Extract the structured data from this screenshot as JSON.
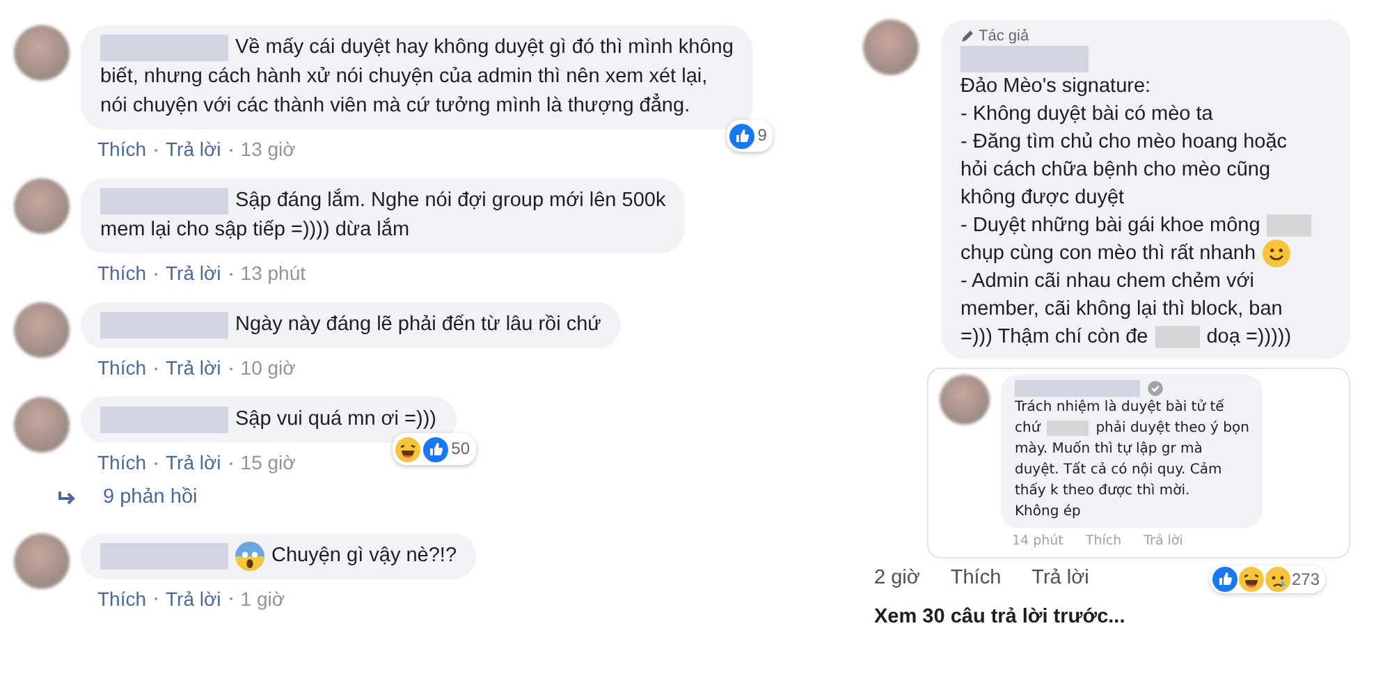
{
  "left_comments": [
    {
      "lines": [
        [
          {
            "kind": "redacted-name"
          },
          {
            "kind": "text",
            "text": "Về mấy cái duyệt hay không duyệt gì đó thì mình không"
          }
        ],
        [
          {
            "kind": "text",
            "text": "biết, nhưng cách hành xử nói chuyện của admin thì nên xem xét lại,"
          }
        ],
        [
          {
            "kind": "text",
            "text": "nói chuyện với các thành viên mà cứ tưởng mình là thượng đẳng."
          }
        ]
      ],
      "reactions": {
        "items": [
          {
            "kind": "like"
          }
        ],
        "count": "9"
      },
      "actions": [
        "Thích",
        "Trả lời"
      ],
      "time": "13 giờ"
    },
    {
      "lines": [
        [
          {
            "kind": "redacted-name"
          },
          {
            "kind": "text",
            "text": "Sập đáng lắm. Nghe nói đợi group mới lên 500k"
          }
        ],
        [
          {
            "kind": "text",
            "text": "mem lại cho sập tiếp =)))) dừa lắm"
          }
        ]
      ],
      "actions": [
        "Thích",
        "Trả lời"
      ],
      "time": "13 phút"
    },
    {
      "lines": [
        [
          {
            "kind": "redacted-name"
          },
          {
            "kind": "text",
            "text": "Ngày này đáng lẽ phải đến từ lâu rồi chứ"
          }
        ]
      ],
      "actions": [
        "Thích",
        "Trả lời"
      ],
      "time": "10 giờ"
    },
    {
      "lines": [
        [
          {
            "kind": "redacted-name"
          },
          {
            "kind": "text",
            "text": "Sập vui quá mn ơi =)))"
          }
        ]
      ],
      "reactions": {
        "items": [
          {
            "kind": "haha"
          },
          {
            "kind": "like"
          }
        ],
        "count": "50"
      },
      "actions": [
        "Thích",
        "Trả lời"
      ],
      "time": "15 giờ",
      "replies": "9 phản hồi"
    },
    {
      "lines": [
        [
          {
            "kind": "redacted-name"
          },
          {
            "kind": "scream-emoji"
          },
          {
            "kind": "text",
            "text": "Chuyện gì vậy nè?!?"
          }
        ]
      ],
      "actions": [
        "Thích",
        "Trả lời"
      ],
      "time": "1 giờ"
    }
  ],
  "author_comment": {
    "badge": "Tác giả",
    "lines": [
      [
        {
          "kind": "redacted-name"
        }
      ],
      [
        {
          "kind": "text",
          "text": "Đảo Mèo's signature:"
        }
      ],
      [
        {
          "kind": "text",
          "text": "- Không duyệt bài có mèo ta"
        }
      ],
      [
        {
          "kind": "text",
          "text": "- Đăng tìm chủ cho mèo hoang hoặc"
        }
      ],
      [
        {
          "kind": "text",
          "text": "hỏi cách chữa bệnh cho mèo cũng"
        }
      ],
      [
        {
          "kind": "text",
          "text": "không được duyệt"
        }
      ],
      [
        {
          "kind": "text",
          "text": "- Duyệt những bài gái khoe mông"
        },
        {
          "kind": "redacted-word"
        }
      ],
      [
        {
          "kind": "text",
          "text": "chụp cùng con mèo thì rất nhanh"
        },
        {
          "kind": "smile-emoji"
        }
      ],
      [
        {
          "kind": "text",
          "text": "- Admin cãi nhau chem chẻm với"
        }
      ],
      [
        {
          "kind": "text",
          "text": "member, cãi không lại thì block, ban"
        }
      ],
      [
        {
          "kind": "text",
          "text": "=))) Thậm chí còn đe"
        },
        {
          "kind": "redacted-word"
        },
        {
          "kind": "text",
          "text": "doạ =)))))"
        }
      ]
    ],
    "reply": {
      "lines": [
        [
          {
            "kind": "redacted-name"
          },
          {
            "kind": "verified-badge"
          }
        ],
        [
          {
            "kind": "text",
            "text": "Trách nhiệm là duyệt bài tử tế"
          }
        ],
        [
          {
            "kind": "text",
            "text": "chứ"
          },
          {
            "kind": "redacted-word"
          },
          {
            "kind": "text",
            "text": "phải duyệt theo ý bọn"
          }
        ],
        [
          {
            "kind": "text",
            "text": "mày. Muốn thì tự lập gr mà"
          }
        ],
        [
          {
            "kind": "text",
            "text": "duyệt. Tất cả có nội quy. Cảm"
          }
        ],
        [
          {
            "kind": "text",
            "text": "thấy k theo được thì mời."
          }
        ],
        [
          {
            "kind": "text",
            "text": "Không ép"
          }
        ]
      ],
      "time": "14 phút",
      "actions": [
        "Thích",
        "Trả lời"
      ]
    },
    "time": "2 giờ",
    "actions": [
      "Thích",
      "Trả lời"
    ],
    "reactions": {
      "items": [
        {
          "kind": "like"
        },
        {
          "kind": "haha"
        },
        {
          "kind": "sad"
        }
      ],
      "count": "273"
    }
  },
  "view_more": "Xem 30 câu trả lời trước..."
}
